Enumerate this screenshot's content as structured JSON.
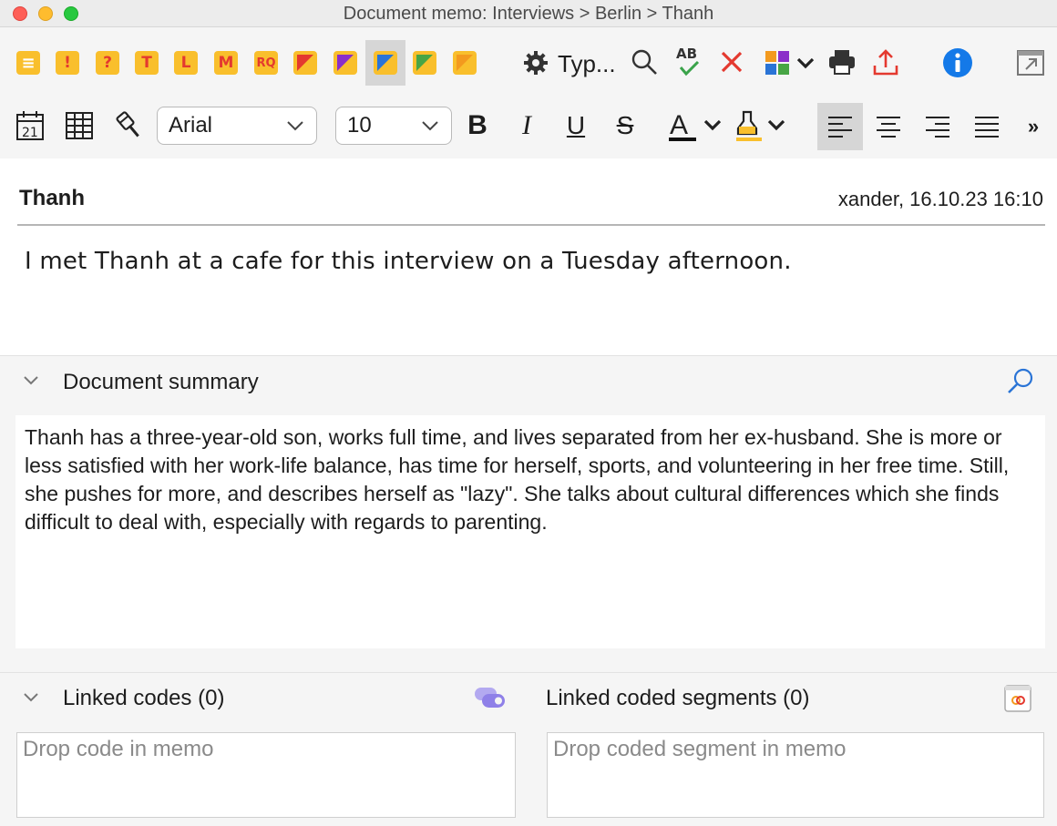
{
  "window": {
    "title": "Document memo: Interviews > Berlin > Thanh"
  },
  "toolbar": {
    "memo_types": [
      {
        "name": "memo-lines-icon",
        "glyph": "≡",
        "color": "#f9bf2c"
      },
      {
        "name": "memo-exclamation-icon",
        "glyph": "!",
        "color": "#f9bf2c"
      },
      {
        "name": "memo-question-icon",
        "glyph": "?",
        "color": "#f9bf2c"
      },
      {
        "name": "memo-t-icon",
        "glyph": "T",
        "color": "#f9bf2c"
      },
      {
        "name": "memo-l-icon",
        "glyph": "L",
        "color": "#f9bf2c"
      },
      {
        "name": "memo-m-icon",
        "glyph": "M",
        "color": "#f9bf2c"
      },
      {
        "name": "memo-rq-icon",
        "glyph": "RQ",
        "color": "#f9bf2c"
      },
      {
        "name": "memo-red-icon",
        "glyph": "",
        "color": "#e4392f"
      },
      {
        "name": "memo-purple-icon",
        "glyph": "",
        "color": "#8b2fc9"
      },
      {
        "name": "memo-blue-icon",
        "glyph": "",
        "color": "#2a74d6"
      },
      {
        "name": "memo-green-icon",
        "glyph": "",
        "color": "#48a545"
      },
      {
        "name": "memo-orange-icon",
        "glyph": "",
        "color": "#f39a1e"
      }
    ],
    "type_label": "Typ...",
    "font_name": "Arial",
    "font_size": "10"
  },
  "memo": {
    "title": "Thanh",
    "meta": "xander, 16.10.23 16:10",
    "body": "I met Thanh at a cafe for this interview on a Tuesday afternoon."
  },
  "summary": {
    "label": "Document summary",
    "text": "Thanh has a three-year-old son, works full time, and lives separated from her ex-husband. She is more or less satisfied with her work-life balance, has time for herself, sports, and volunteering in her free time. Still, she pushes for more, and describes herself as \"lazy\". She talks about cultural differences which she finds difficult to deal with, especially with regards to parenting."
  },
  "linked": {
    "codes_label": "Linked codes (0)",
    "segments_label": "Linked coded segments (0)",
    "codes_placeholder": "Drop code in memo",
    "segments_placeholder": "Drop coded segment in memo"
  }
}
